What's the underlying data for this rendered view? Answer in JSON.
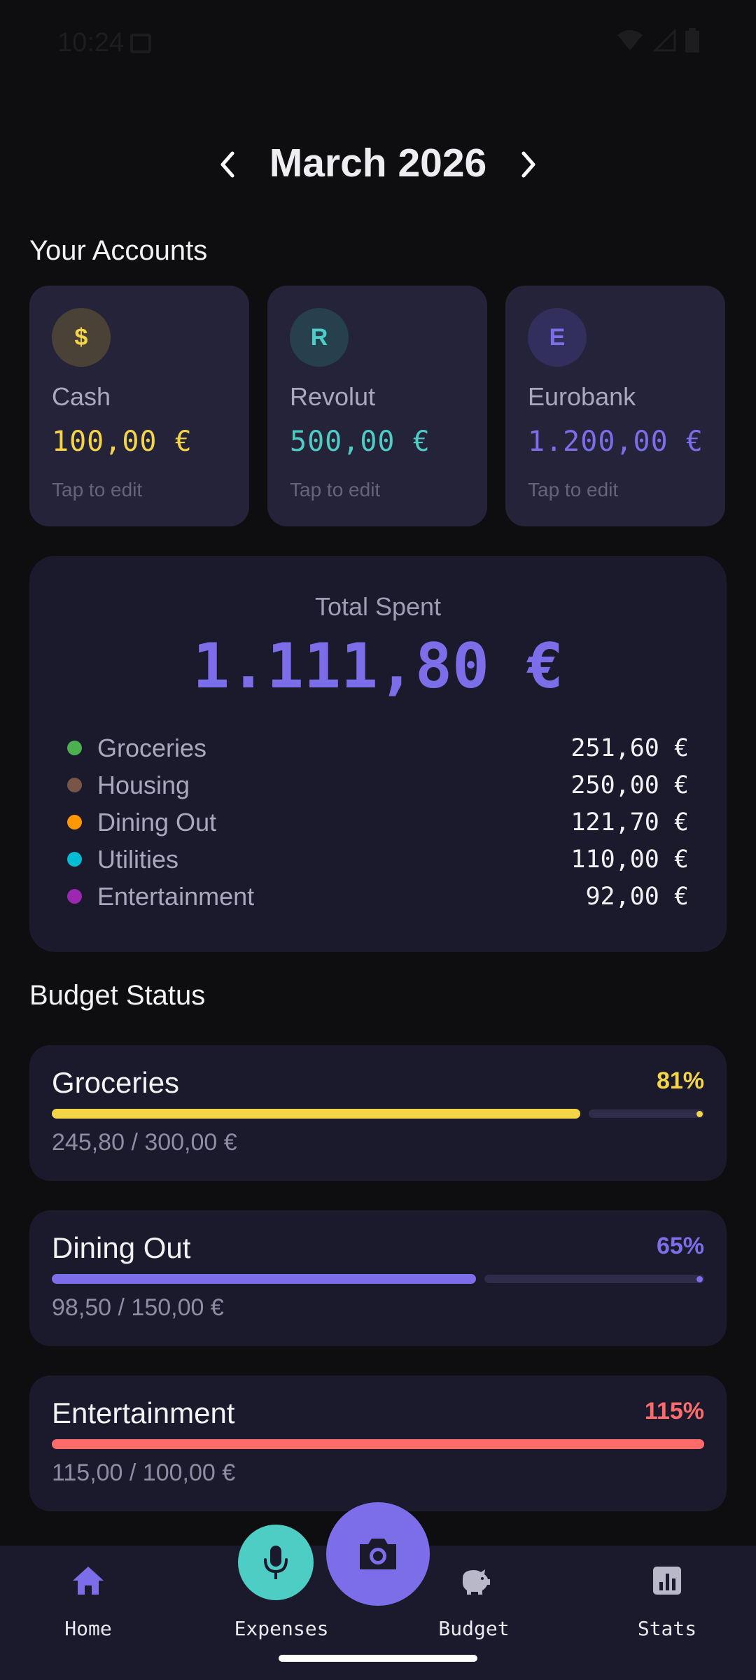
{
  "status_bar": {
    "time": "10:24"
  },
  "header": {
    "month": "March 2026",
    "prev_icon": "chevron-left-icon",
    "next_icon": "chevron-right-icon"
  },
  "accounts": {
    "title": "Your Accounts",
    "items": [
      {
        "initial": "$",
        "name": "Cash",
        "amount": "100,00 €",
        "hint": "Tap to edit",
        "color": "#f5d548",
        "avatar_bg": "#4a4236"
      },
      {
        "initial": "R",
        "name": "Revolut",
        "amount": "500,00 €",
        "hint": "Tap to edit",
        "color": "#4ecdc4",
        "avatar_bg": "#27404d"
      },
      {
        "initial": "E",
        "name": "Eurobank",
        "amount": "1.200,00 €",
        "hint": "Tap to edit",
        "color": "#7b6ee8",
        "avatar_bg": "#332f5c"
      }
    ]
  },
  "total": {
    "label": "Total Spent",
    "amount": "1.111,80 €",
    "categories": [
      {
        "name": "Groceries",
        "value": "251,60 €",
        "color": "#4caf50"
      },
      {
        "name": "Housing",
        "value": "250,00 €",
        "color": "#795548"
      },
      {
        "name": "Dining Out",
        "value": "121,70 €",
        "color": "#ff9800"
      },
      {
        "name": "Utilities",
        "value": "110,00 €",
        "color": "#00bcd4"
      },
      {
        "name": "Entertainment",
        "value": "92,00 €",
        "color": "#9c27b0"
      }
    ]
  },
  "budget": {
    "title": "Budget Status",
    "items": [
      {
        "name": "Groceries",
        "percent": "81%",
        "progress": 0.81,
        "detail": "245,80 / 300,00 €",
        "color": "#f5d548"
      },
      {
        "name": "Dining Out",
        "percent": "65%",
        "progress": 0.65,
        "detail": "98,50 / 150,00 €",
        "color": "#7b6ee8"
      },
      {
        "name": "Entertainment",
        "percent": "115%",
        "progress": 1.0,
        "detail": "115,00 / 100,00 €",
        "color": "#ff6b6b"
      }
    ]
  },
  "nav": {
    "home": "Home",
    "expenses": "Expenses",
    "budget": "Budget",
    "stats": "Stats",
    "accent": "#7b6ee8"
  }
}
